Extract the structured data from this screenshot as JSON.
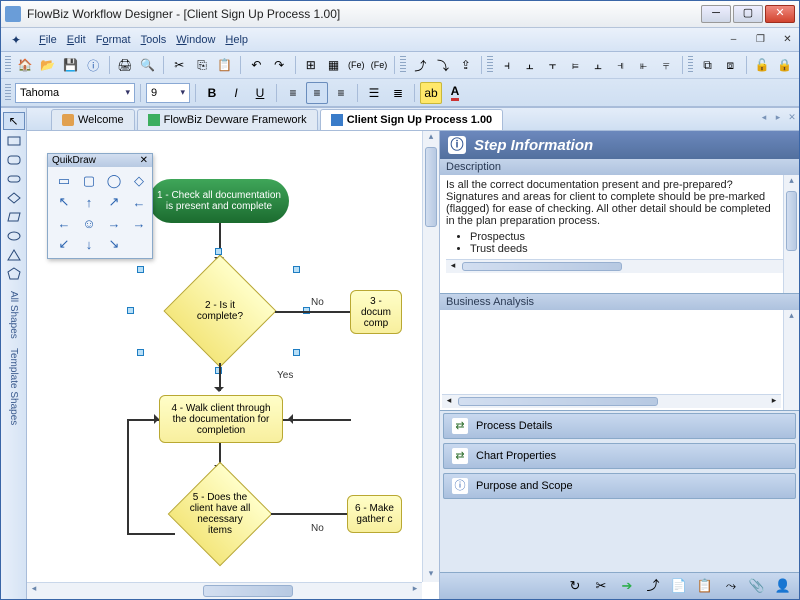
{
  "window": {
    "title": "FlowBiz Workflow Designer - [Client Sign Up Process 1.00]"
  },
  "menu": {
    "file": "File",
    "edit": "Edit",
    "format": "Format",
    "tools": "Tools",
    "window": "Window",
    "help": "Help"
  },
  "font": {
    "family": "Tahoma",
    "size": "9"
  },
  "tabs": [
    {
      "label": "Welcome"
    },
    {
      "label": "FlowBiz Devware Framework"
    },
    {
      "label": "Client Sign Up Process 1.00"
    }
  ],
  "quikdraw": {
    "title": "QuikDraw"
  },
  "flowchart": {
    "step1": "1 - Check all documentation is present and complete",
    "step2": "2 - Is it complete?",
    "step3": "3 - docum comp",
    "step4": "4 - Walk client through the documentation for completion",
    "step5": "5 - Does the client have all necessary items",
    "step6": "6 - Make gather c",
    "yes": "Yes",
    "no": "No"
  },
  "sidepanel": {
    "heading": "Step Information",
    "desc_title": "Description",
    "desc_text": "Is all the correct documentation present and pre-prepared? Signatures and areas for client to complete should be pre-marked (flagged) for ease of checking.  All other detail should be completed in the plan preparation process.",
    "desc_bullets": [
      "Prospectus",
      "Trust deeds"
    ],
    "ba_title": "Business Analysis",
    "collapsed": [
      {
        "label": "Process Details",
        "icon": "⇄"
      },
      {
        "label": "Chart Properties",
        "icon": "⇄"
      },
      {
        "label": "Purpose and Scope",
        "icon": "ⓘ"
      }
    ]
  },
  "leftbar_labels": {
    "all": "All Shapes",
    "tmpl": "Template Shapes"
  }
}
